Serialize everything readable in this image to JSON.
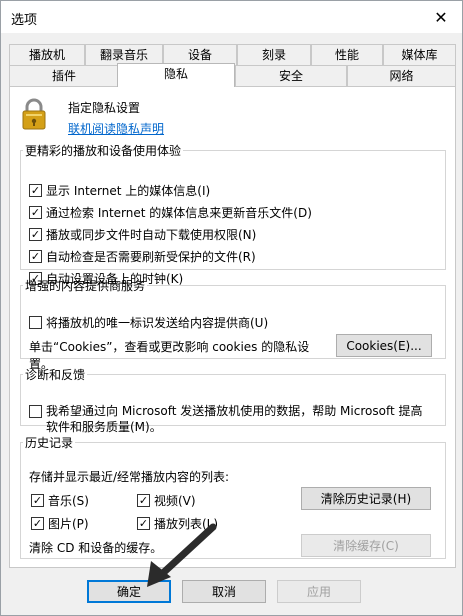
{
  "window": {
    "title": "选项",
    "close_glyph": "✕"
  },
  "tabs": {
    "row1": [
      "播放机",
      "翻录音乐",
      "设备",
      "刻录",
      "性能",
      "媒体库"
    ],
    "row2": [
      "插件",
      "隐私",
      "安全",
      "网络"
    ],
    "selected": "隐私"
  },
  "privacy": {
    "heading": "指定隐私设置",
    "link": "联机阅读隐私声明",
    "experience": {
      "legend": "更精彩的播放和设备使用体验",
      "items": [
        {
          "label": "显示 Internet 上的媒体信息(I)",
          "checked": true
        },
        {
          "label": "通过检索 Internet 的媒体信息来更新音乐文件(D)",
          "checked": true
        },
        {
          "label": "播放或同步文件时自动下载使用权限(N)",
          "checked": true
        },
        {
          "label": "自动检查是否需要刷新受保护的文件(R)",
          "checked": true
        },
        {
          "label": "自动设置设备上的时钟(K)",
          "checked": true
        }
      ]
    },
    "provider": {
      "legend": "增强的内容提供商服务",
      "checkbox": {
        "label": "将播放机的唯一标识发送给内容提供商(U)",
        "checked": false
      },
      "desc_line1": "单击“Cookies”，查看或更改影响 cookies 的隐私设",
      "desc_line2": "置。",
      "button": "Cookies(E)..."
    },
    "feedback": {
      "legend": "诊断和反馈",
      "checkbox": {
        "line1": "我希望通过向 Microsoft 发送播放机使用的数据，帮助 Microsoft 提高",
        "line2": "软件和服务质量(M)。",
        "checked": false
      }
    },
    "history": {
      "legend": "历史记录",
      "list_label": "存储并显示最近/经常播放内容的列表:",
      "items": [
        {
          "label": "音乐(S)",
          "checked": true
        },
        {
          "label": "视频(V)",
          "checked": true
        },
        {
          "label": "图片(P)",
          "checked": true
        },
        {
          "label": "播放列表(L)",
          "checked": true
        }
      ],
      "clear_history_button": "清除历史记录(H)",
      "cache_label": "清除 CD 和设备的缓存。",
      "clear_cache_button": "清除缓存(C)"
    }
  },
  "footer": {
    "ok": "确定",
    "cancel": "取消",
    "apply": "应用"
  },
  "icons": {
    "lock": "lock-icon",
    "check": "✓",
    "cursor": "mouse-pointer-icon"
  },
  "colors": {
    "link": "#0066cc",
    "default_button_border": "#0078d7",
    "lock_gold": "#d4a017"
  }
}
